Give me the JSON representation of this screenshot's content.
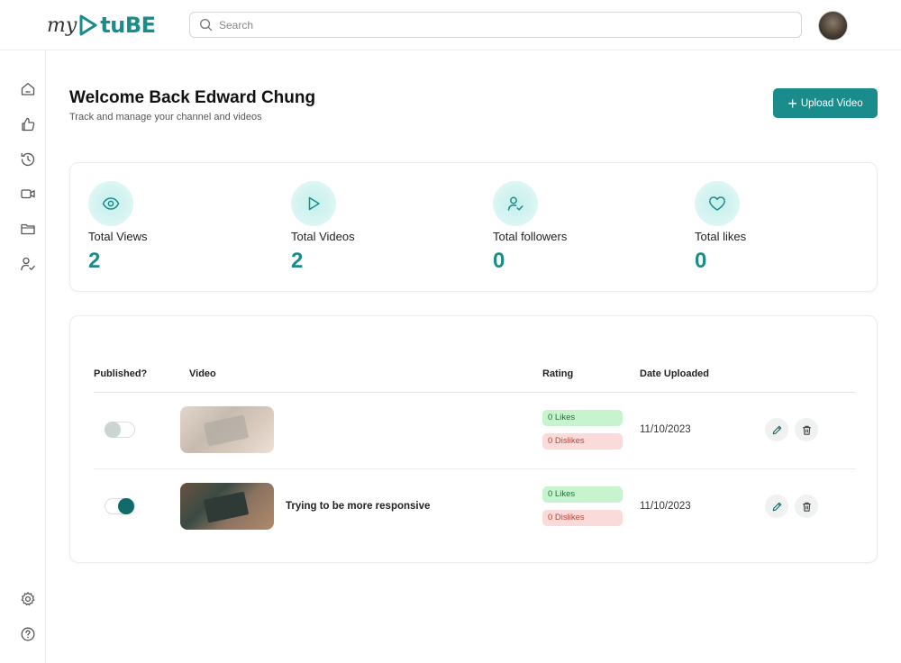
{
  "brand": {
    "logo_my": "my",
    "logo_tube": "tuBE"
  },
  "search": {
    "placeholder": "Search"
  },
  "header": {
    "title": "Welcome Back Edward Chung",
    "subtitle": "Track and manage your channel and videos",
    "upload_label": "Upload Video"
  },
  "sidebar": {
    "items": [
      {
        "icon": "home-icon"
      },
      {
        "icon": "thumbs-up-icon"
      },
      {
        "icon": "history-icon"
      },
      {
        "icon": "video-camera-icon"
      },
      {
        "icon": "folder-icon"
      },
      {
        "icon": "user-check-icon"
      }
    ],
    "bottom": [
      {
        "icon": "gear-icon"
      },
      {
        "icon": "help-icon"
      }
    ]
  },
  "stats": [
    {
      "label": "Total Views",
      "value": "2",
      "icon": "eye-icon"
    },
    {
      "label": "Total Videos",
      "value": "2",
      "icon": "play-icon"
    },
    {
      "label": "Total followers",
      "value": "0",
      "icon": "user-check-icon"
    },
    {
      "label": "Total likes",
      "value": "0",
      "icon": "heart-icon"
    }
  ],
  "table": {
    "headers": {
      "published": "Published?",
      "video": "Video",
      "rating": "Rating",
      "date": "Date Uploaded"
    },
    "rows": [
      {
        "published": false,
        "title": "",
        "likes": "0 Likes",
        "dislikes": "0 Dislikes",
        "date": "11/10/2023"
      },
      {
        "published": true,
        "title": "Trying to be more responsive",
        "likes": "0 Likes",
        "dislikes": "0 Dislikes",
        "date": "11/10/2023"
      }
    ]
  },
  "colors": {
    "accent": "#1a8c8c",
    "likes_bg": "#c8f3cf",
    "dislikes_bg": "#fbdada"
  }
}
